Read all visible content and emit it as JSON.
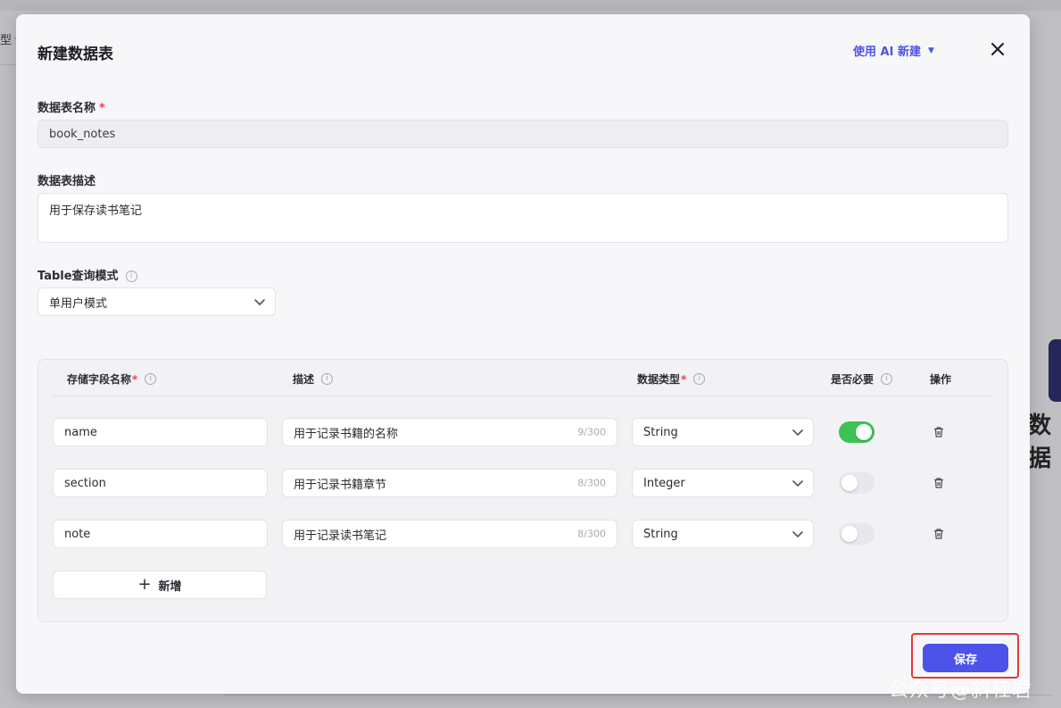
{
  "background": {
    "left_label": "型 ▾",
    "right_text": "数据",
    "watermark": "公众号@斜杠君"
  },
  "modal": {
    "title": "新建数据表",
    "ai_create_label": "使用 AI 新建",
    "close_icon": "close-icon"
  },
  "form": {
    "name_label": "数据表名称",
    "name_required": "*",
    "name_value": "book_notes",
    "desc_label": "数据表描述",
    "desc_value": "用于保存读书笔记",
    "mode_label": "Table查询模式",
    "mode_value": "单用户模式"
  },
  "table": {
    "headers": {
      "field_name": "存储字段名称",
      "field_required": "*",
      "description": "描述",
      "data_type": "数据类型",
      "type_required": "*",
      "is_required": "是否必要",
      "actions": "操作"
    },
    "rows": [
      {
        "name": "name",
        "description": "用于记录书籍的名称",
        "counter": "9/300",
        "type": "String",
        "required": true
      },
      {
        "name": "section",
        "description": "用于记录书籍章节",
        "counter": "8/300",
        "type": "Integer",
        "required": false
      },
      {
        "name": "note",
        "description": "用于记录读书笔记",
        "counter": "8/300",
        "type": "String",
        "required": false
      }
    ],
    "add_label": "新增"
  },
  "footer": {
    "save_label": "保存"
  },
  "colors": {
    "accent": "#4d53e8",
    "toggle_on": "#3ec254",
    "highlight_border": "#e53935"
  }
}
